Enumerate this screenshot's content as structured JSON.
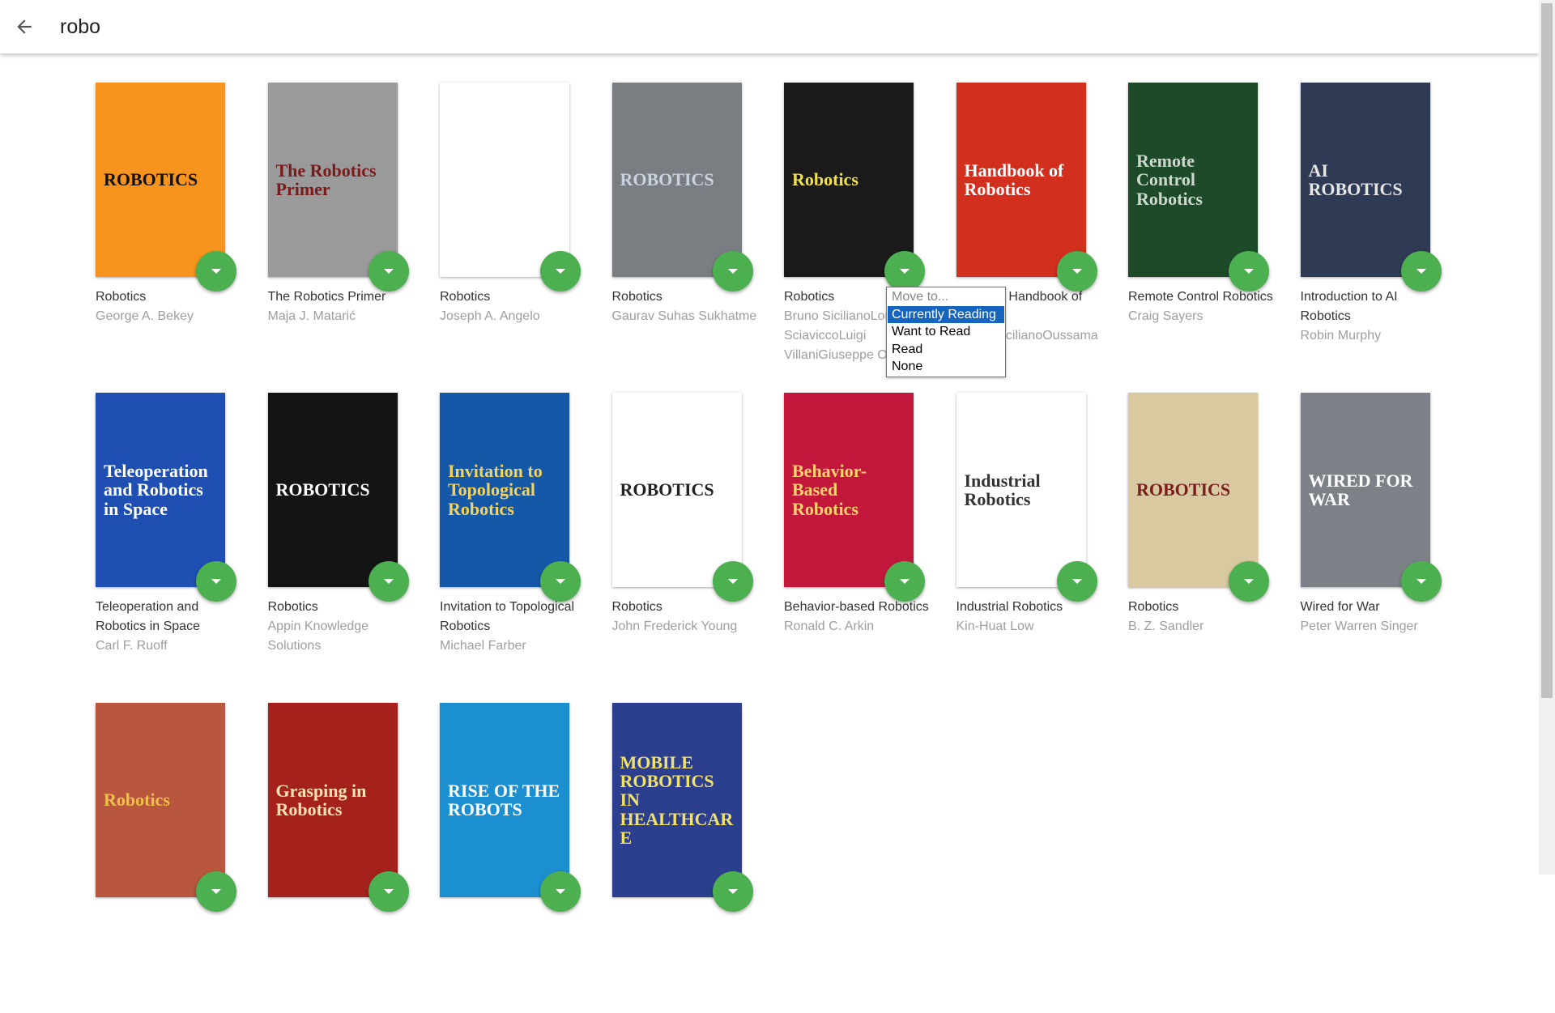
{
  "search": {
    "value": "robo"
  },
  "books": [
    {
      "title": "Robotics",
      "author": "George A. Bekey",
      "cover_bg": "#f7941d",
      "cover_text": "ROBOTICS",
      "cover_fg": "#111"
    },
    {
      "title": "The Robotics Primer",
      "author": "Maja J. Matarić",
      "cover_bg": "#9a9a9a",
      "cover_text": "The Robotics Primer",
      "cover_fg": "#7a1a1a"
    },
    {
      "title": "Robotics",
      "author": "Joseph A. Angelo",
      "cover_bg": "#ffffff",
      "cover_text": "",
      "cover_fg": "#000"
    },
    {
      "title": "Robotics",
      "author": "Gaurav Suhas Sukhatme",
      "cover_bg": "#7a7d82",
      "cover_text": "ROBOTICS",
      "cover_fg": "#c9d3e0"
    },
    {
      "title": "Robotics",
      "author": "Bruno SicilianoLorenzo SciaviccoLuigi VillaniGiuseppe Oriolo",
      "cover_bg": "#1a1a1a",
      "cover_text": "Robotics",
      "cover_fg": "#f1e14a"
    },
    {
      "title": "Springer Handbook of Robotics",
      "author": "Bruno SicilianoOussama Khatib",
      "cover_bg": "#d32f1f",
      "cover_text": "Handbook of Robotics",
      "cover_fg": "#ffffff"
    },
    {
      "title": "Remote Control Robotics",
      "author": "Craig Sayers",
      "cover_bg": "#1d4b2a",
      "cover_text": "Remote Control Robotics",
      "cover_fg": "#cfd8cf"
    },
    {
      "title": "Introduction to AI Robotics",
      "author": "Robin Murphy",
      "cover_bg": "#2f3b55",
      "cover_text": "AI ROBOTICS",
      "cover_fg": "#e6e6e6"
    },
    {
      "title": "Teleoperation and Robotics in Space",
      "author": "Carl F. Ruoff",
      "cover_bg": "#1f4fb3",
      "cover_text": "Teleoperation and Robotics in Space",
      "cover_fg": "#ffffff"
    },
    {
      "title": "Robotics",
      "author": "Appin Knowledge Solutions",
      "cover_bg": "#141414",
      "cover_text": "ROBOTICS",
      "cover_fg": "#ffffff"
    },
    {
      "title": "Invitation to Topological Robotics",
      "author": "Michael Farber",
      "cover_bg": "#1558a8",
      "cover_text": "Invitation to Topological Robotics",
      "cover_fg": "#f5d35a"
    },
    {
      "title": "Robotics",
      "author": "John Frederick Young",
      "cover_bg": "#ffffff",
      "cover_text": "ROBOTICS",
      "cover_fg": "#222"
    },
    {
      "title": "Behavior-based Robotics",
      "author": "Ronald C. Arkin",
      "cover_bg": "#c2183b",
      "cover_text": "Behavior-Based Robotics",
      "cover_fg": "#ffd36b"
    },
    {
      "title": "Industrial Robotics",
      "author": "Kin-Huat Low",
      "cover_bg": "#ffffff",
      "cover_text": "Industrial Robotics",
      "cover_fg": "#333"
    },
    {
      "title": "Robotics",
      "author": "B. Z. Sandler",
      "cover_bg": "#d9c9a0",
      "cover_text": "ROBOTICS",
      "cover_fg": "#7a1d1d"
    },
    {
      "title": "Wired for War",
      "author": "Peter Warren Singer",
      "cover_bg": "#7c8188",
      "cover_text": "WIRED FOR WAR",
      "cover_fg": "#ffffff"
    },
    {
      "title": "",
      "author": "",
      "cover_bg": "#b8563e",
      "cover_text": "Robotics",
      "cover_fg": "#f0c04a"
    },
    {
      "title": "",
      "author": "",
      "cover_bg": "#a5221c",
      "cover_text": "Grasping in Robotics",
      "cover_fg": "#ffe2b0"
    },
    {
      "title": "",
      "author": "",
      "cover_bg": "#1c8fd0",
      "cover_text": "RISE OF THE ROBOTS",
      "cover_fg": "#ffffff"
    },
    {
      "title": "",
      "author": "",
      "cover_bg": "#2c3f8f",
      "cover_text": "MOBILE ROBOTICS IN HEALTHCARE",
      "cover_fg": "#f3e26a"
    }
  ],
  "move_menu": {
    "placeholder": "Move to...",
    "options": [
      "Currently Reading",
      "Want to Read",
      "Read",
      "None"
    ],
    "selected": "Currently Reading"
  },
  "colors": {
    "fab": "#4caf50",
    "menu_selected": "#1565c0"
  }
}
